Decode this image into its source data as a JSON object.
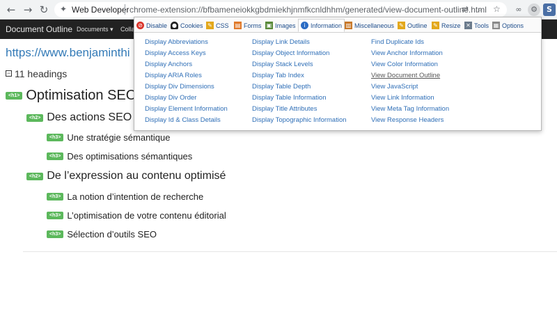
{
  "browser": {
    "omnibox_origin": "Web Developer",
    "omnibox_url": "chrome-extension://bfbameneiokkgbdmiekhjnmfkcnldhhm/generated/view-document-outline.html"
  },
  "navbar": {
    "brand": "Document Outline",
    "menus": [
      "Documents",
      "Colla"
    ]
  },
  "page": {
    "url_text": "https://www.benjaminthi",
    "headings_count": "11 headings"
  },
  "outline": {
    "h1": {
      "badge": "<h1>",
      "text": "Optimisation SEO"
    },
    "items": [
      {
        "badge": "<h2>",
        "text": "Des actions SEO"
      },
      {
        "badge": "<h3>",
        "text": "Une stratégie sémantique"
      },
      {
        "badge": "<h3>",
        "text": "Des optimisations sémantiques"
      },
      {
        "badge": "<h2>",
        "text": "De l’expression au contenu optimisé"
      },
      {
        "badge": "<h3>",
        "text": "La notion d’intention de recherche"
      },
      {
        "badge": "<h3>",
        "text": "L’optimisation de votre contenu éditorial"
      },
      {
        "badge": "<h3>",
        "text": "Sélection d’outils SEO"
      }
    ]
  },
  "webdev": {
    "tabs": [
      "Disable",
      "Cookies",
      "CSS",
      "Forms",
      "Images",
      "Information",
      "Miscellaneous",
      "Outline",
      "Resize",
      "Tools",
      "Options"
    ],
    "active_tab": "Information",
    "col1": [
      "Display Abbreviations",
      "Display Access Keys",
      "Display Anchors",
      "Display ARIA Roles",
      "Display Div Dimensions",
      "Display Div Order",
      "Display Element Information",
      "Display Id & Class Details"
    ],
    "col2": [
      "Display Link Details",
      "Display Object Information",
      "Display Stack Levels",
      "Display Tab Index",
      "Display Table Depth",
      "Display Table Information",
      "Display Title Attributes",
      "Display Topographic Information"
    ],
    "col3": [
      "Find Duplicate Ids",
      "View Anchor Information",
      "View Color Information",
      "View Document Outline",
      "View JavaScript",
      "View Link Information",
      "View Meta Tag Information",
      "View Response Headers"
    ]
  },
  "colors": {
    "link": "#337ab7",
    "badge": "#5cb85c",
    "navbar": "#222222",
    "menu_link": "#2f6fb7"
  }
}
